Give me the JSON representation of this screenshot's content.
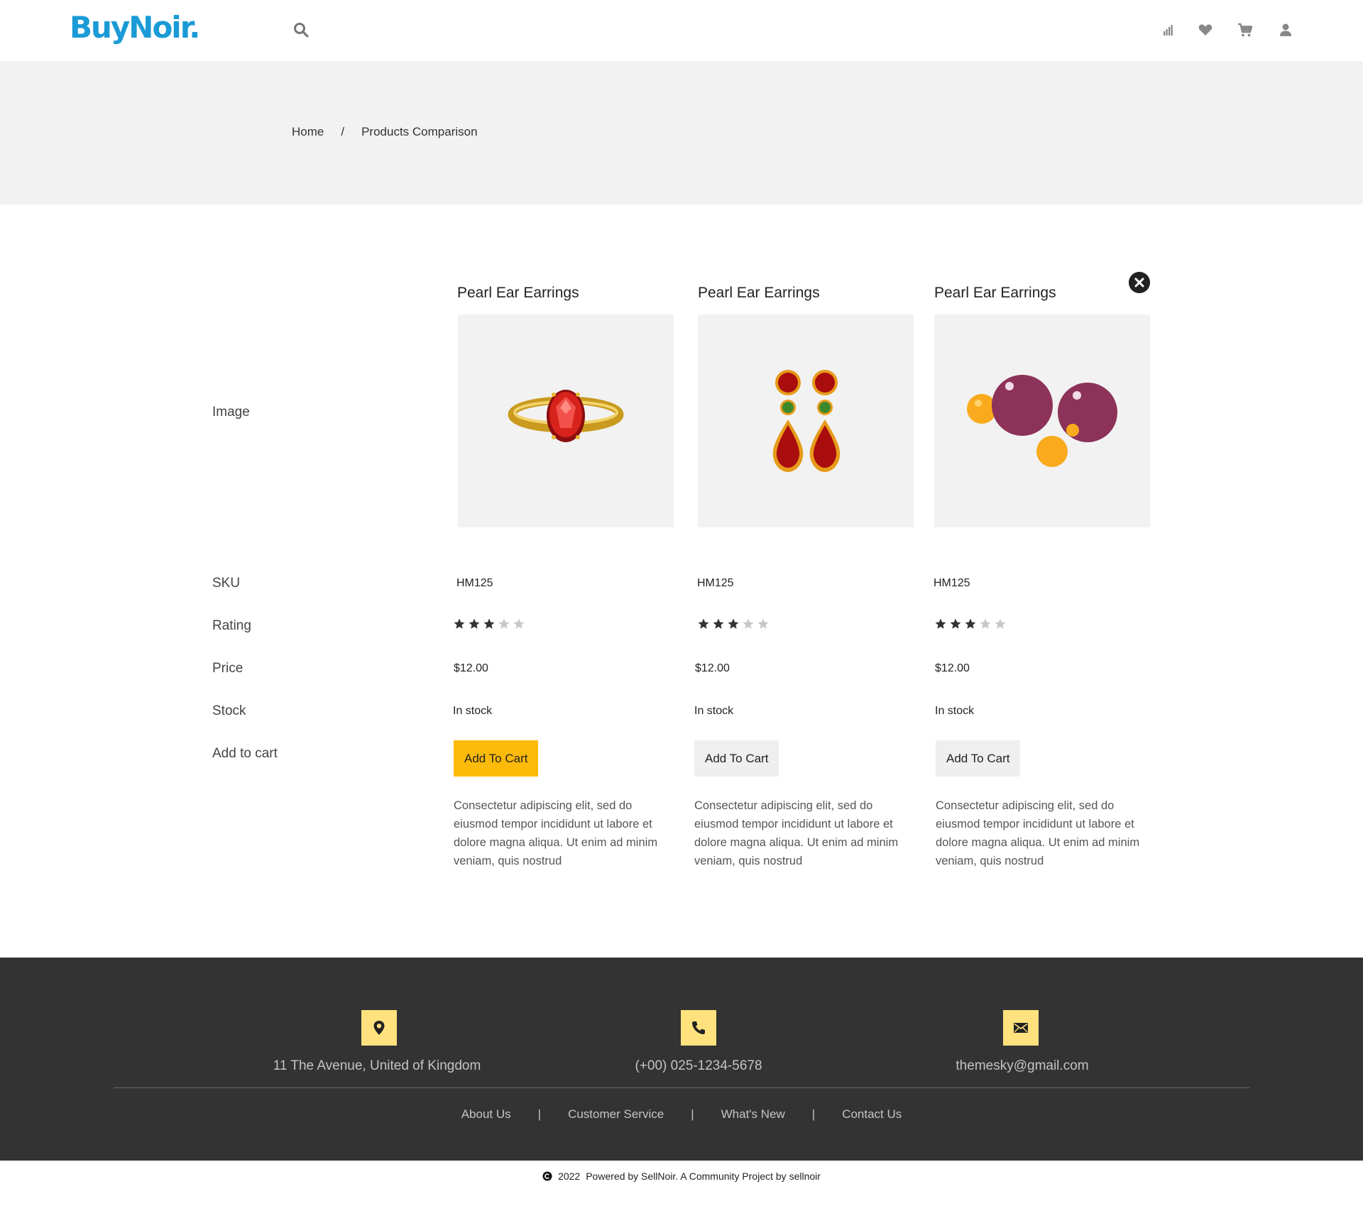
{
  "header": {
    "logo": "BuyNoir.",
    "icons": [
      "search-icon",
      "compare-icon",
      "heart-icon",
      "cart-icon",
      "user-icon"
    ]
  },
  "breadcrumb": {
    "home": "Home",
    "separator": "/",
    "current": "Products Comparison"
  },
  "rows": {
    "image": "Image",
    "sku": "SKU",
    "rating": "Rating",
    "price": "Price",
    "stock": "Stock",
    "add_to_cart": "Add to cart"
  },
  "products": [
    {
      "title": "Pearl Ear Earrings",
      "image": "ruby-ring",
      "sku": "HM125",
      "rating": 3,
      "rating_max": 5,
      "price": "$12.00",
      "stock": "In stock",
      "button": "Add To Cart",
      "description": "Consectetur adipiscing elit, sed do eiusmod tempor incididunt ut labore et dolore magna aliqua. Ut enim ad minim veniam, quis nostrud"
    },
    {
      "title": "Pearl Ear Earrings",
      "image": "ruby-drop-earrings",
      "sku": "HM125",
      "rating": 3,
      "rating_max": 5,
      "price": "$12.00",
      "stock": "In stock",
      "button": "Add To Cart",
      "description": "Consectetur adipiscing elit, sed do eiusmod tempor incididunt ut labore et dolore magna aliqua. Ut enim ad minim veniam, quis nostrud"
    },
    {
      "title": "Pearl Ear Earrings",
      "image": "pearl-beads",
      "sku": "HM125",
      "rating": 3,
      "rating_max": 5,
      "price": "$12.00",
      "stock": "In stock",
      "button": "Add To Cart",
      "description": "Consectetur adipiscing elit, sed do eiusmod tempor incididunt ut labore et dolore magna aliqua. Ut enim ad minim veniam, quis nostrud"
    }
  ],
  "footer": {
    "address": "11 The Avenue, United of Kingdom",
    "phone": "(+00) 025-1234-5678",
    "email": "themesky@gmail.com",
    "links": [
      "About Us",
      "Customer Service",
      "What's New",
      "Contact Us"
    ],
    "link_separator": "|",
    "copyright_year": "2022",
    "copyright_text": "Powered by SellNoir. A Community Project by sellnoir"
  },
  "colors": {
    "brand": "#1a9ad6",
    "accent": "#fcba09",
    "footer_bg": "#333333",
    "footer_icon_bg": "#ffe27d",
    "star_filled": "#333333",
    "star_empty": "#c8c8c8"
  }
}
